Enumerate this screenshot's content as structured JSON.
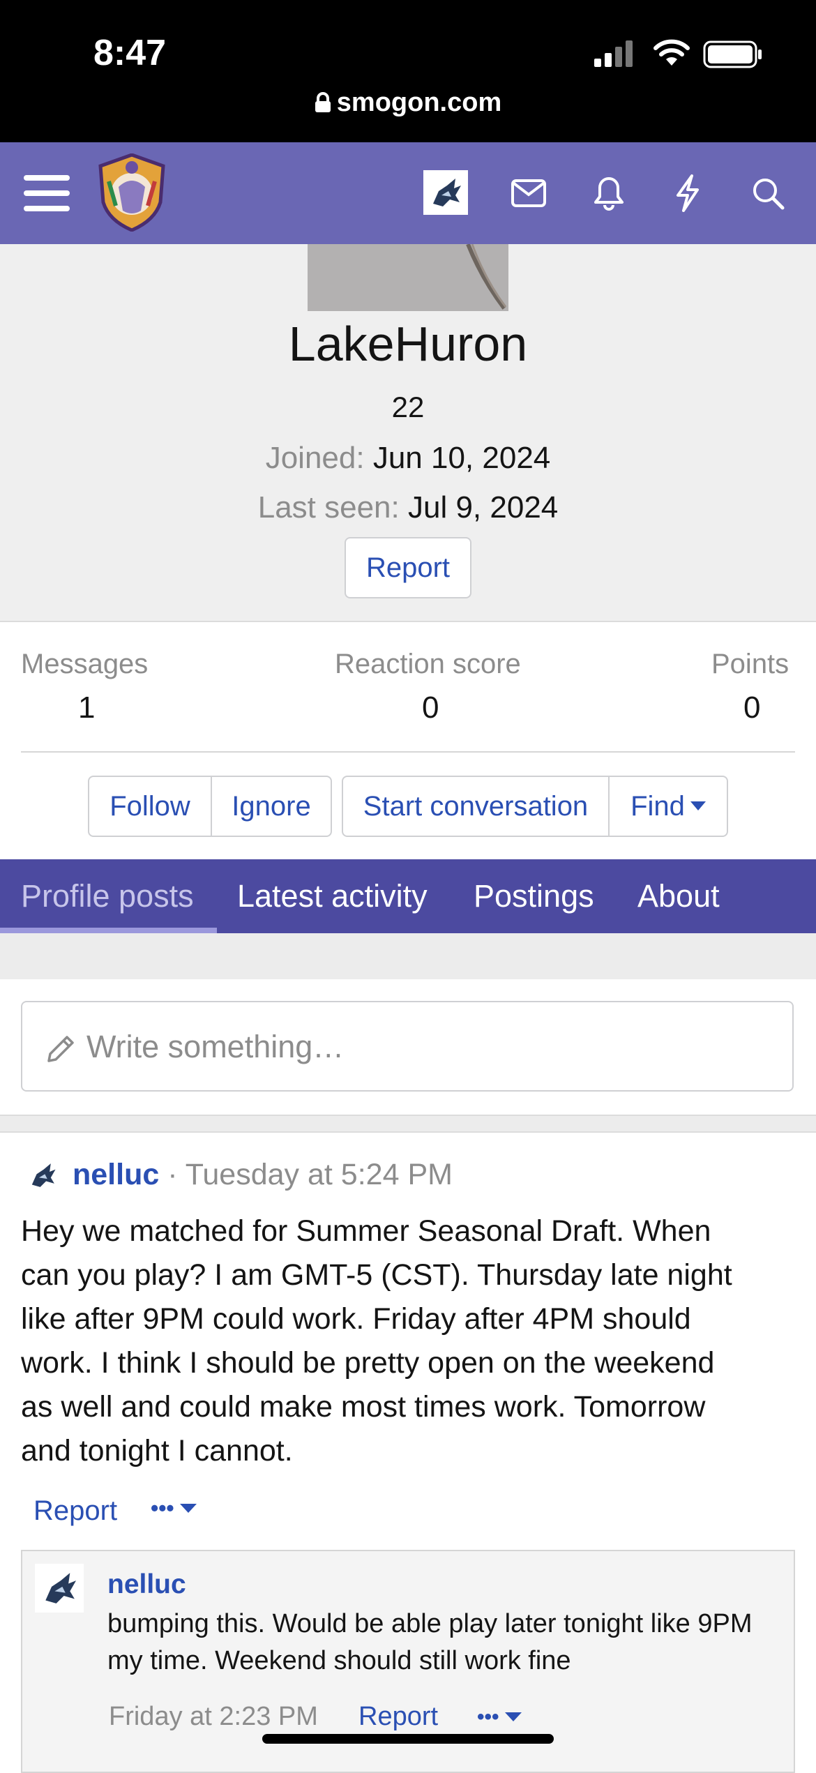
{
  "status": {
    "time": "8:47",
    "url": "smogon.com"
  },
  "profile": {
    "username": "LakeHuron",
    "age": "22",
    "joined_label": "Joined:",
    "joined_value": "Jun 10, 2024",
    "last_seen_label": "Last seen:",
    "last_seen_value": "Jul 9, 2024",
    "report_label": "Report"
  },
  "stats": [
    {
      "label": "Messages",
      "value": "1"
    },
    {
      "label": "Reaction score",
      "value": "0"
    },
    {
      "label": "Points",
      "value": "0"
    }
  ],
  "actions": {
    "follow": "Follow",
    "ignore": "Ignore",
    "start_conversation": "Start conversation",
    "find": "Find"
  },
  "tabs": [
    "Profile posts",
    "Latest activity",
    "Postings",
    "About"
  ],
  "write_placeholder": "Write something…",
  "post": {
    "author": "nelluc",
    "separator": "·",
    "time": "Tuesday at 5:24 PM",
    "lines": [
      "Hey we matched for Summer Seasonal Draft. When",
      "can you play? I am GMT-5 (CST). Thursday late night",
      "like after 9PM could work. Friday after 4PM should",
      "work. I think I should be pretty open on the weekend",
      "as well and could make most times work. Tomorrow",
      "and tonight I cannot."
    ],
    "report_label": "Report",
    "more_label": "•••"
  },
  "reply": {
    "author": "nelluc",
    "lines": [
      "bumping this. Would be able play later tonight like 9PM",
      "my time. Weekend should still work fine"
    ],
    "time": "Friday at 2:23 PM",
    "report_label": "Report",
    "more_label": "•••"
  },
  "colors": {
    "nav": "#6a67b4",
    "tabs": "#4c4aa0",
    "link": "#2a4fb3"
  }
}
